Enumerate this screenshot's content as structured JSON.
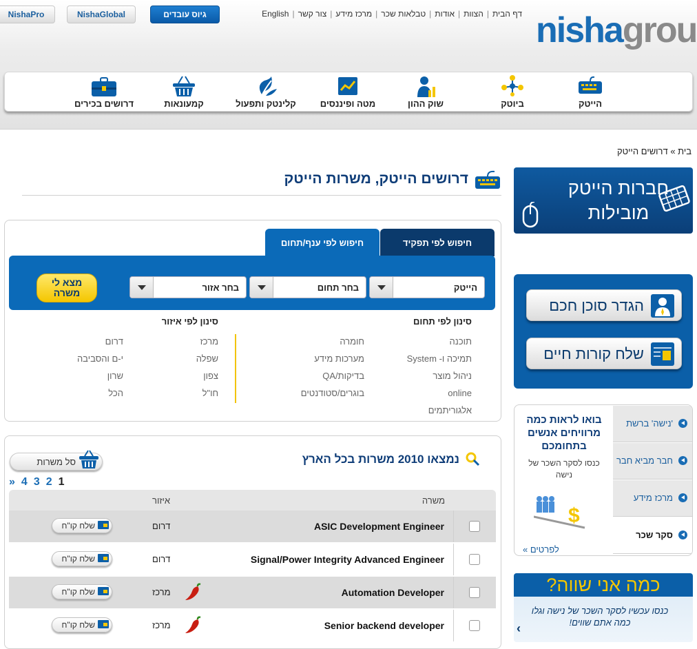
{
  "top_buttons": {
    "nisha_pro": "NishaPro",
    "nisha_global": "NishaGlobal",
    "recruit": "גיוס עובדים"
  },
  "top_links": [
    "דף הבית",
    "הצוות",
    "אודות",
    "טבלאות שכר",
    "מרכז מידע",
    "צור קשר",
    "English"
  ],
  "logo": {
    "part1": "nisha",
    "part2": "group"
  },
  "nav": [
    "הייטק",
    "ביוטק",
    "שוק ההון",
    "מטה ופיננסים",
    "קלינטק ותפעול",
    "קמעונאות",
    "דרושים בכירים"
  ],
  "breadcrumb": "בית » דרושים הייטק",
  "page_title": "דרושים הייטק, משרות הייטק",
  "search": {
    "tab_role": "חיפוש לפי תפקיד",
    "tab_field": "חיפוש לפי ענף/תחום",
    "select_sector": "הייטק",
    "select_field": "בחר תחום",
    "select_area": "בחר אזור",
    "find_button": "מצא לי משרה"
  },
  "filters": {
    "field_title": "סינון לפי תחום",
    "area_title": "סינון לפי איזור",
    "field_col1": [
      "תוכנה",
      "תמיכה ו- System",
      "ניהול מוצר",
      "online",
      "אלגוריתמים"
    ],
    "field_col2": [
      "חומרה",
      "מערכות מידע",
      "בדיקות/QA",
      "בוגרים/סטודנטים"
    ],
    "area_col1": [
      "מרכז",
      "שפלה",
      "צפון",
      "חו\"ל"
    ],
    "area_col2": [
      "דרום",
      "י-ם והסביבה",
      "שרון",
      "הכל"
    ]
  },
  "results": {
    "title": "נמצאו 2010 משרות בכל הארץ",
    "basket": "סל משרות",
    "pager": [
      "»",
      "4",
      "3",
      "2",
      "1"
    ],
    "col_job": "משרה",
    "col_area": "איזור",
    "send_cv": "שלח קו\"ח",
    "rows": [
      {
        "job": "ASIC Development Engineer",
        "area": "דרום"
      },
      {
        "job": "Signal/Power Integrity Advanced Engineer",
        "area": "דרום"
      },
      {
        "job": "Automation Developer",
        "area": "מרכז"
      },
      {
        "job": "Senior backend developer",
        "area": "מרכז"
      }
    ]
  },
  "sidebar": {
    "banner1": "חברות הייטק מובילות",
    "agent_button": "הגדר סוכן חכם",
    "cv_button": "שלח קורות חיים",
    "tabs": [
      "'נישה' ברשת",
      "חבר מביא חבר",
      "מרכז מידע",
      "סקר שכר"
    ],
    "info_head": "בואו לראות כמה מרוויחים אנשים בתחומכם",
    "info_sub": "כנסו לסקר השכר של נישה",
    "info_more": "לפרטים »",
    "worth_head": "כמה אני שווה?",
    "worth_sub": "כנסו עכשיו לסקר השכר של נישה וגלו כמה אתם שווים!",
    "worth_arrow": "‹"
  },
  "colors": {
    "brand_blue": "#0b6ab8",
    "dark_blue": "#0b3a6c",
    "yellow": "#f4c600",
    "grey_logo": "#8a8a8a"
  }
}
